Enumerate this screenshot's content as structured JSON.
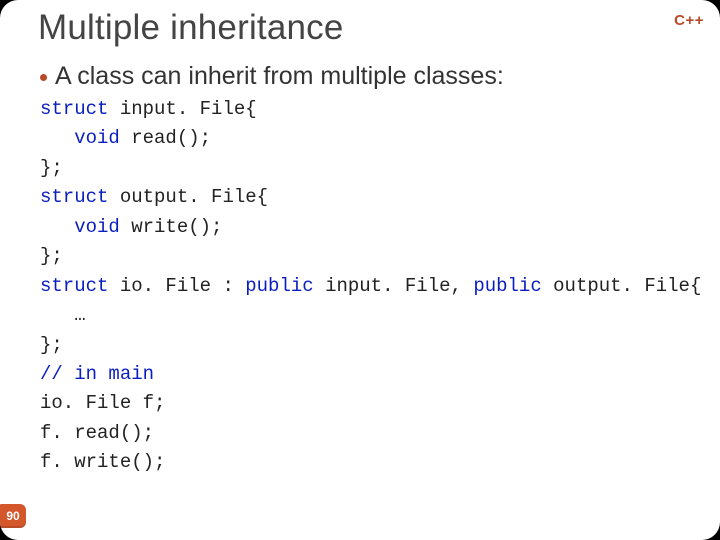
{
  "header": {
    "title": "Multiple inheritance",
    "logo": "C++"
  },
  "bullet": {
    "text": "A class can inherit from multiple classes:"
  },
  "code": {
    "l1_kw": "struct",
    "l1_rest": " input. File{",
    "l2_kw": "void",
    "l2_rest": " read();",
    "l3": "};",
    "l4_kw": "struct",
    "l4_rest": " output. File{",
    "l5_kw": "void",
    "l5_rest": " write();",
    "l6": "};",
    "l7_kw1": "struct",
    "l7_mid1": " io. File : ",
    "l7_kw2": "public",
    "l7_mid2": " input. File, ",
    "l7_kw3": "public",
    "l7_mid3": " output. File{",
    "l8": "   …",
    "l9": "};",
    "l10": "// in main",
    "l11": "io. File f;",
    "l12": "f. read();",
    "l13": "f. write();"
  },
  "footer": {
    "page": "90"
  }
}
